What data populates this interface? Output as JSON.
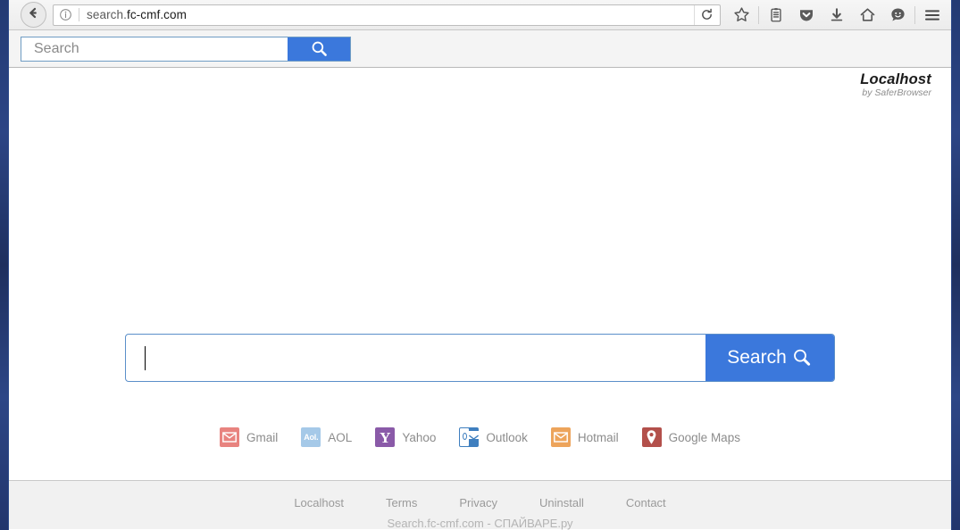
{
  "browser": {
    "back_icon": "back-arrow-icon",
    "info_icon": "page-info-icon",
    "url_prefix": "search.",
    "url_domain": "fc-cmf.com",
    "reload_icon": "reload-icon",
    "toolbar_icons": [
      {
        "name": "bookmark-star-icon",
        "title": "Bookmark this page"
      },
      {
        "name": "library-icon",
        "title": "Library"
      },
      {
        "name": "pocket-icon",
        "title": "Save to Pocket"
      },
      {
        "name": "downloads-icon",
        "title": "Downloads"
      },
      {
        "name": "home-icon",
        "title": "Home"
      },
      {
        "name": "feedback-smiley-icon",
        "title": "Feedback"
      },
      {
        "name": "hamburger-menu-icon",
        "title": "Open menu"
      }
    ]
  },
  "search_toolbar": {
    "placeholder": "Search",
    "value": "",
    "button_icon": "magnifier-icon"
  },
  "brand": {
    "name": "Localhost",
    "subtitle": "by SaferBrowser"
  },
  "main_search": {
    "value": "",
    "placeholder": "",
    "button_label": "Search",
    "button_icon": "magnifier-icon"
  },
  "shortcuts": [
    {
      "label": "Gmail",
      "icon": "gmail-icon",
      "color": "#e8837f",
      "glyph": "envelope"
    },
    {
      "label": "AOL",
      "icon": "aol-icon",
      "color": "#a5c9e8",
      "glyph": "Aol."
    },
    {
      "label": "Yahoo",
      "icon": "yahoo-icon",
      "color": "#8a5aa8",
      "glyph": "Y"
    },
    {
      "label": "Outlook",
      "icon": "outlook-icon",
      "color": "#3f7fbf",
      "glyph": "o"
    },
    {
      "label": "Hotmail",
      "icon": "hotmail-icon",
      "color": "#eda45b",
      "glyph": "envelope"
    },
    {
      "label": "Google Maps",
      "icon": "google-maps-icon",
      "color": "#b3504b",
      "glyph": "pin"
    }
  ],
  "footer": {
    "links": [
      {
        "label": "Localhost"
      },
      {
        "label": "Terms"
      },
      {
        "label": "Privacy"
      },
      {
        "label": "Uninstall"
      },
      {
        "label": "Contact"
      }
    ],
    "watermark": "Search.fc-cmf.com - СПАЙВАРЕ.ру"
  },
  "colors": {
    "accent_blue": "#3b78dc",
    "desktop_blue": "#21366b",
    "muted_text": "#8c8c8c"
  }
}
